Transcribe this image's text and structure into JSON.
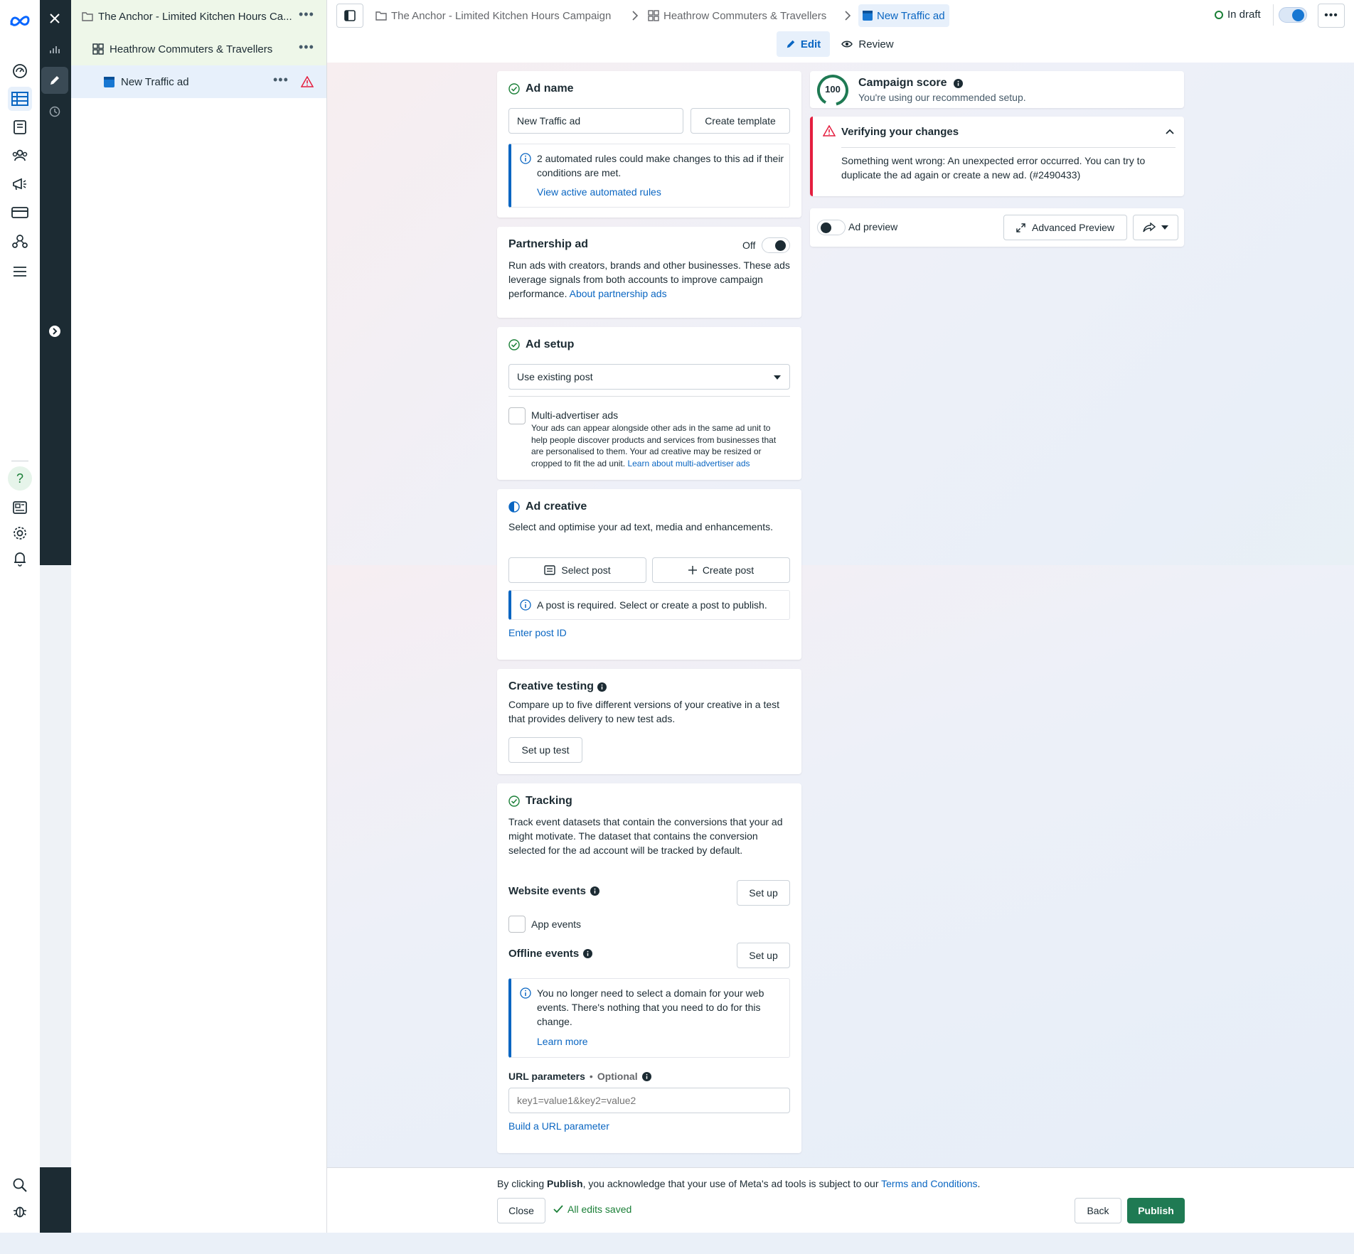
{
  "colors": {
    "accent": "#0a66c2",
    "error": "#e41e3f",
    "success": "#1a7f37",
    "publish": "#1f7a53",
    "dark_rail": "#1c2b33"
  },
  "rail": {
    "icons": [
      "meta-logo-icon",
      "gauge-icon",
      "campaigns-table-icon",
      "pages-icon",
      "audiences-icon",
      "megaphone-icon",
      "billing-card-icon",
      "business-tools-icon",
      "menu-icon",
      "help-icon",
      "news-icon",
      "settings-icon",
      "notifications-bell-icon",
      "search-icon",
      "bug-icon"
    ],
    "help_label": "?"
  },
  "tree": {
    "campaign": "The Anchor - Limited Kitchen Hours Ca...",
    "adset": "Heathrow Commuters & Travellers",
    "ad": "New Traffic ad"
  },
  "header": {
    "crumb_campaign": "The Anchor - Limited Kitchen Hours Campaign",
    "crumb_adset": "Heathrow Commuters & Travellers",
    "crumb_ad": "New Traffic ad",
    "status": "In draft",
    "tab_edit": "Edit",
    "tab_review": "Review"
  },
  "ad_name": {
    "title": "Ad name",
    "value": "New Traffic ad",
    "create_template": "Create template",
    "info_text": "2 automated rules could make changes to this ad if their conditions are met.",
    "info_link": "View active automated rules"
  },
  "partnership": {
    "title": "Partnership ad",
    "toggle_label": "Off",
    "text": "Run ads with creators, brands and other businesses. These ads leverage signals from both accounts to improve campaign performance.",
    "link": "About partnership ads"
  },
  "ad_setup": {
    "title": "Ad setup",
    "select_value": "Use existing post",
    "multi_title": "Multi-advertiser ads",
    "multi_text": "Your ads can appear alongside other ads in the same ad unit to help people discover products and services from businesses that are personalised to them. Your ad creative may be resized or cropped to fit the ad unit.",
    "multi_link": "Learn about multi-advertiser ads"
  },
  "ad_creative": {
    "title": "Ad creative",
    "subtitle": "Select and optimise your ad text, media and enhancements.",
    "select_post": "Select post",
    "create_post": "Create post",
    "info_text": "A post is required. Select or create a post to publish.",
    "enter_id": "Enter post ID"
  },
  "creative_testing": {
    "title": "Creative testing",
    "text": "Compare up to five different versions of your creative in a test that provides delivery to new test ads.",
    "button": "Set up test"
  },
  "tracking": {
    "title": "Tracking",
    "text": "Track event datasets that contain the conversions that your ad might motivate. The dataset that contains the conversion selected for the ad account will be tracked by default.",
    "website_events": "Website events",
    "setup_1": "Set up",
    "app_events": "App events",
    "offline_events": "Offline events",
    "setup_2": "Set up",
    "info_text": "You no longer need to select a domain for your web events. There's nothing that you need to do for this change.",
    "info_link": "Learn more",
    "url_params_label": "URL parameters",
    "url_params_optional": "Optional",
    "url_params_placeholder": "key1=value1&key2=value2",
    "build_link": "Build a URL parameter"
  },
  "score": {
    "value": "100",
    "title": "Campaign score",
    "subtitle": "You're using our recommended setup."
  },
  "verify": {
    "title": "Verifying your changes",
    "text": "Something went wrong: An unexpected error occurred. You can try to duplicate the ad again or create a new ad. (#2490433)"
  },
  "preview": {
    "label": "Ad preview",
    "advanced": "Advanced Preview"
  },
  "footer": {
    "prefix": "By clicking ",
    "publish_word": "Publish",
    "middle": ", you acknowledge that your use of Meta's ad tools is subject to our ",
    "terms": "Terms and Conditions",
    "suffix": ".",
    "close": "Close",
    "saved": "All edits saved",
    "back": "Back",
    "publish": "Publish"
  }
}
